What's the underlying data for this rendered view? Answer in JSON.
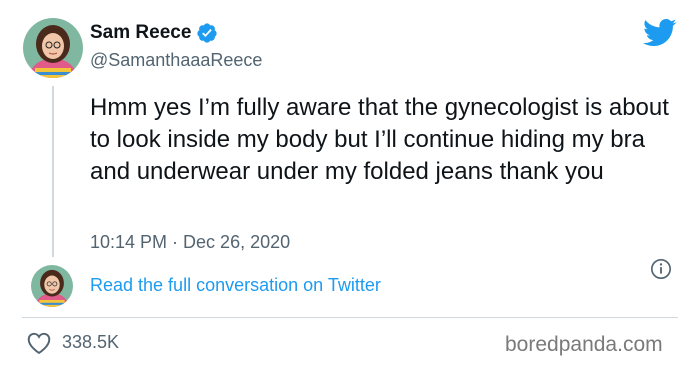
{
  "tweet": {
    "display_name": "Sam Reece",
    "handle": "@SamanthaaaReece",
    "text": "Hmm yes I’m fully aware that the gynecologist is about to look inside my body but I’ll continue hiding my bra and underwear under my folded jeans thank you",
    "timestamp": "10:14 PM · Dec 26, 2020",
    "verified": true
  },
  "conversation": {
    "link_text": "Read the full conversation on Twitter"
  },
  "engagement": {
    "likes": "338.5K"
  },
  "watermark": "boredpanda.com",
  "icons": {
    "brand": "twitter-bird-icon",
    "verified": "verified-badge-icon",
    "info": "info-icon",
    "like": "heart-icon"
  },
  "colors": {
    "brand_blue": "#1d9bf0",
    "text_primary": "#0f1419",
    "text_secondary": "#536471",
    "divider": "#cfd9de"
  }
}
